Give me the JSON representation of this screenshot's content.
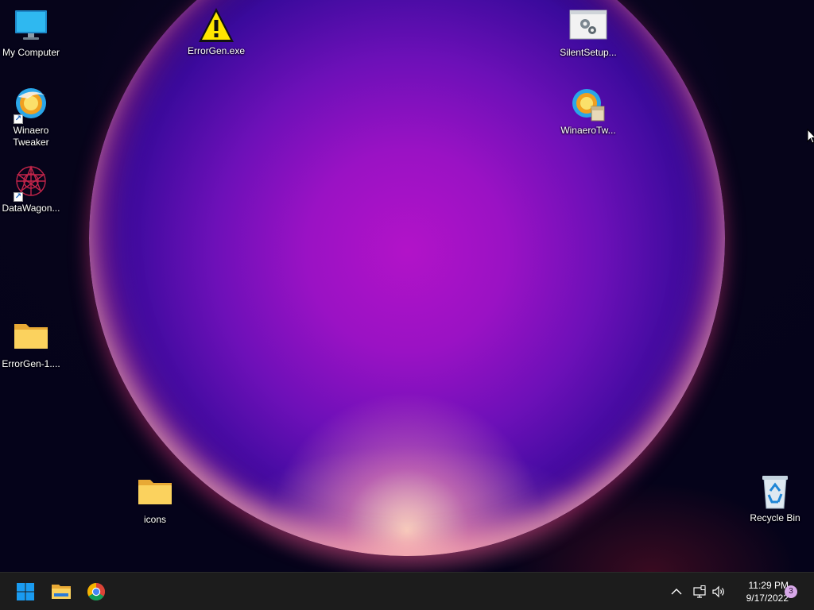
{
  "desktop": {
    "icons": [
      {
        "id": "my-computer",
        "label": "My Computer"
      },
      {
        "id": "errorgen-exe",
        "label": "ErrorGen.exe"
      },
      {
        "id": "silentsetup",
        "label": "SilentSetup..."
      },
      {
        "id": "winaero-tweaker",
        "label": "Winaero\nTweaker"
      },
      {
        "id": "winaerotw",
        "label": "WinaeroTw..."
      },
      {
        "id": "datawagon",
        "label": "DataWagon..."
      },
      {
        "id": "errorgen-folder",
        "label": "ErrorGen-1...."
      },
      {
        "id": "icons-folder",
        "label": "icons"
      },
      {
        "id": "recycle-bin",
        "label": "Recycle Bin"
      }
    ]
  },
  "taskbar": {
    "pinned": [
      {
        "name": "Start",
        "icon": "windows-logo-icon"
      },
      {
        "name": "File Explorer",
        "icon": "folder-icon"
      },
      {
        "name": "Google Chrome",
        "icon": "chrome-icon"
      }
    ],
    "tray": {
      "icons": [
        "chevron-up-icon",
        "network-icon",
        "speaker-icon"
      ],
      "time": "11:29 PM",
      "date": "9/17/2022",
      "notification_count": "3"
    }
  },
  "colors": {
    "taskbar_bg": "#1c1c1c",
    "accent": "#1a9bf0",
    "folder": "#f8c94a"
  }
}
